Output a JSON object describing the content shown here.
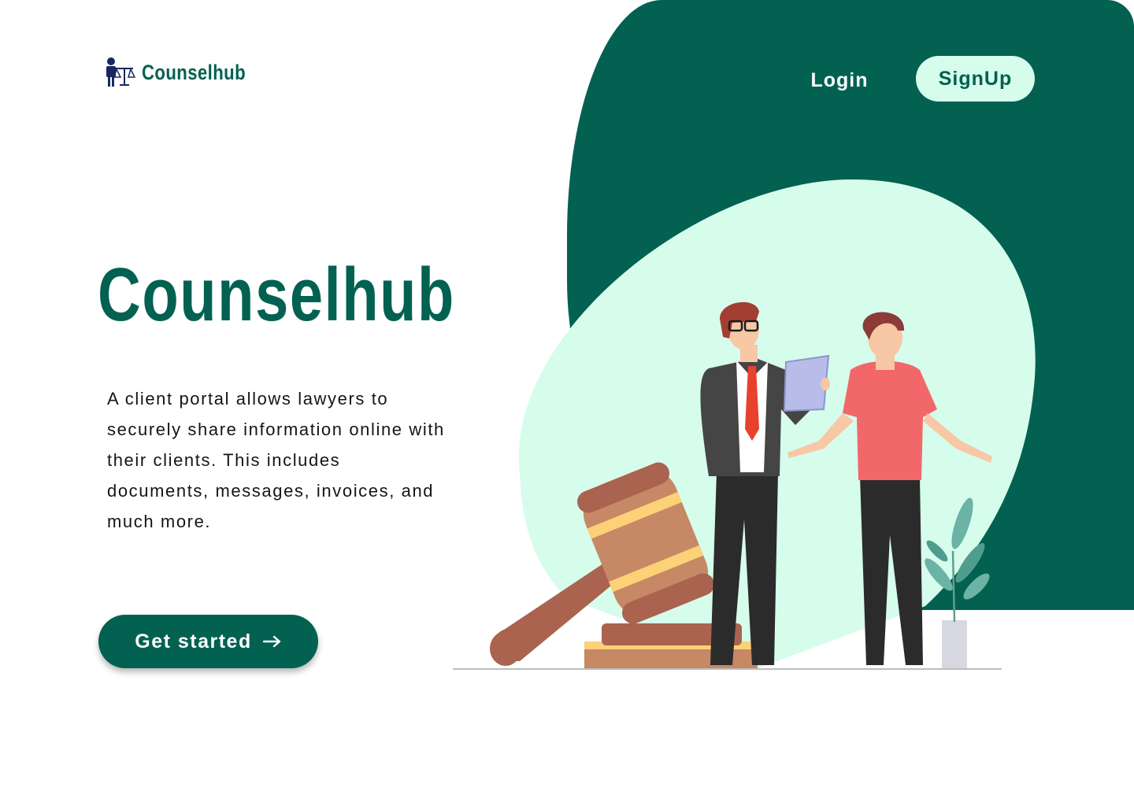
{
  "brand": {
    "name": "Counselhub",
    "logo_icon": "lawyer-scales-icon"
  },
  "nav": {
    "login_label": "Login",
    "signup_label": "SignUp"
  },
  "hero": {
    "title": "Counselhub",
    "description": "A client portal allows lawyers to securely share information online with their clients. This includes documents, messages, invoices, and much more.",
    "cta_label": "Get started",
    "cta_icon": "arrow-right-icon"
  },
  "colors": {
    "primary": "#026150",
    "accent_light": "#d6fcec",
    "text": "#151515",
    "background": "#ffffff"
  },
  "illustration": {
    "icons": [
      "gavel-icon",
      "lawyer-figure-icon",
      "client-figure-icon",
      "tablet-icon",
      "plant-icon"
    ]
  }
}
